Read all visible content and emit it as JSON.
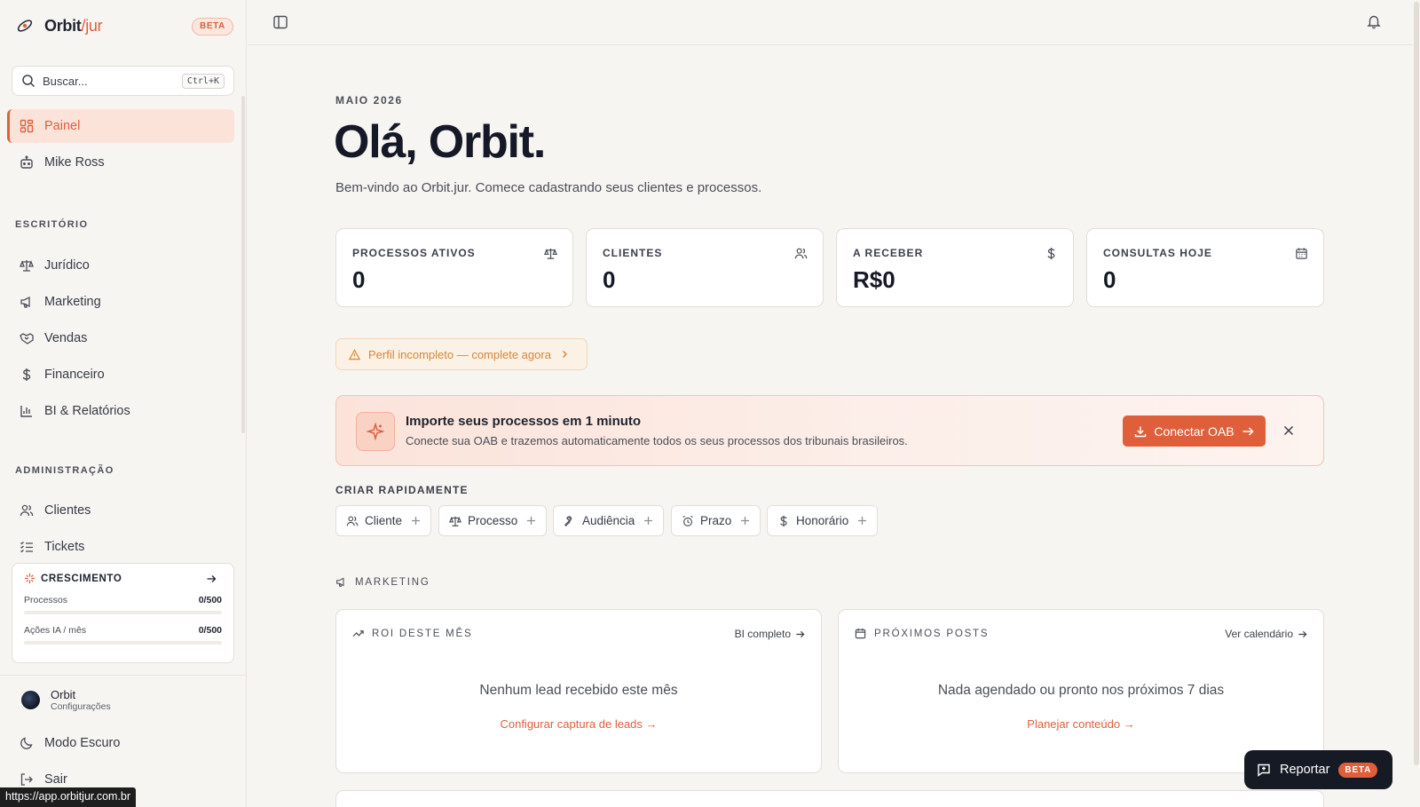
{
  "brand": {
    "name": "Orbit",
    "slash": "/",
    "suffix": "jur",
    "badge": "BETA"
  },
  "search": {
    "placeholder": "Buscar...",
    "shortcut": "Ctrl+K"
  },
  "nav_top": [
    {
      "label": "Painel",
      "icon": "dashboard-icon",
      "active": true
    },
    {
      "label": "Mike Ross",
      "icon": "robot-icon"
    }
  ],
  "sections": {
    "office": {
      "label": "ESCRITÓRIO",
      "items": [
        {
          "label": "Jurídico",
          "icon": "scale-icon"
        },
        {
          "label": "Marketing",
          "icon": "megaphone-icon"
        },
        {
          "label": "Vendas",
          "icon": "handshake-icon"
        },
        {
          "label": "Financeiro",
          "icon": "dollar-icon"
        },
        {
          "label": "BI & Relatórios",
          "icon": "bar-chart-icon"
        }
      ]
    },
    "admin": {
      "label": "ADMINISTRAÇÃO",
      "items": [
        {
          "label": "Clientes",
          "icon": "users-icon"
        },
        {
          "label": "Tickets",
          "icon": "list-check-icon"
        }
      ]
    }
  },
  "growth": {
    "title": "CRESCIMENTO",
    "rows": [
      {
        "label": "Processos",
        "value": "0/500",
        "progress": 0
      },
      {
        "label": "Ações IA / mês",
        "value": "0/500",
        "progress": 0
      }
    ]
  },
  "user": {
    "name": "Orbit",
    "subtitle": "Configurações"
  },
  "footer_nav": [
    {
      "label": "Modo Escuro",
      "icon": "moon-icon"
    },
    {
      "label": "Sair",
      "icon": "logout-icon"
    }
  ],
  "status_url": "https://app.orbitjur.com.br",
  "main": {
    "eyebrow": "MAIO 2026",
    "greeting": "Olá, Orbit.",
    "welcome": "Bem-vindo ao Orbit.jur. Comece cadastrando seus clientes e processos.",
    "stats": [
      {
        "label": "PROCESSOS ATIVOS",
        "value": "0",
        "icon": "scale-icon"
      },
      {
        "label": "CLIENTES",
        "value": "0",
        "icon": "users-icon"
      },
      {
        "label": "A RECEBER",
        "value": "R$0",
        "icon": "dollar-icon"
      },
      {
        "label": "CONSULTAS HOJE",
        "value": "0",
        "icon": "calendar-icon"
      }
    ],
    "warning": "Perfil incompleto — complete agora",
    "import": {
      "title": "Importe seus processos em 1 minuto",
      "description": "Conecte sua OAB e trazemos automaticamente todos os seus processos dos tribunais brasileiros.",
      "button": "Conectar OAB"
    },
    "quick_create": {
      "label": "CRIAR RAPIDAMENTE",
      "items": [
        {
          "label": "Cliente",
          "icon": "users-icon"
        },
        {
          "label": "Processo",
          "icon": "scale-icon"
        },
        {
          "label": "Audiência",
          "icon": "gavel-icon"
        },
        {
          "label": "Prazo",
          "icon": "alarm-icon"
        },
        {
          "label": "Honorário",
          "icon": "dollar-icon"
        }
      ]
    },
    "marketing": {
      "label": "MARKETING",
      "cards": [
        {
          "title": "ROI DESTE MÊS",
          "link": "BI completo",
          "empty": "Nenhum lead recebido este mês",
          "cta": "Configurar captura de leads →"
        },
        {
          "title": "PRÓXIMOS POSTS",
          "link": "Ver calendário",
          "empty": "Nada agendado ou pronto nos próximos 7 dias",
          "cta": "Planejar conteúdo →"
        }
      ]
    }
  },
  "report": {
    "label": "Reportar",
    "badge": "BETA"
  },
  "colors": {
    "accent": "#df5f3b",
    "warning": "#d4883e",
    "dark": "#161a24"
  }
}
